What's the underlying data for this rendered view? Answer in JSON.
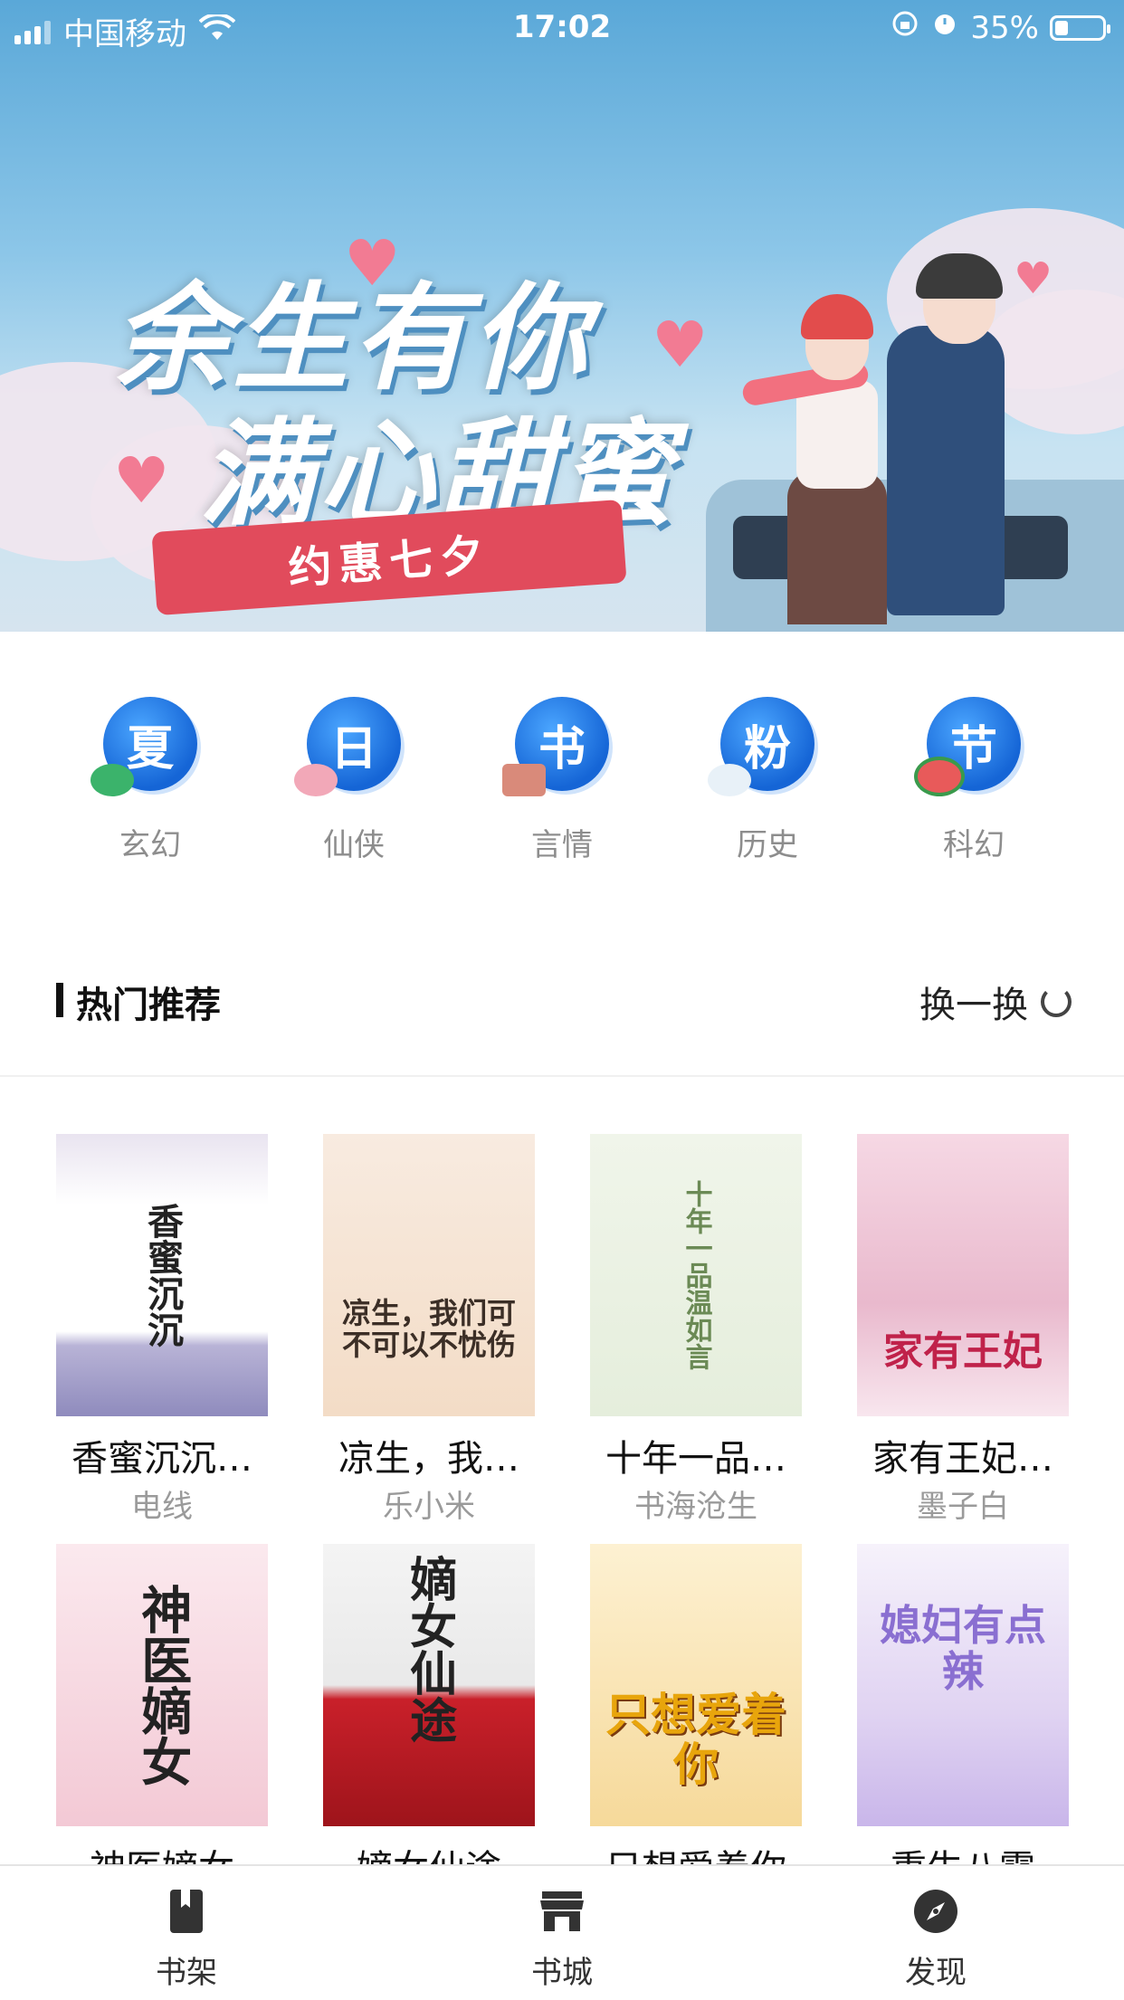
{
  "status_bar": {
    "carrier": "中国移动",
    "time": "17:02",
    "battery": "35%"
  },
  "banner": {
    "title_line1": "余生有你",
    "title_line2": "满心甜蜜",
    "ribbon": "约惠七夕"
  },
  "categories": [
    {
      "icon_text": "夏",
      "label": "玄幻"
    },
    {
      "icon_text": "日",
      "label": "仙侠"
    },
    {
      "icon_text": "书",
      "label": "言情"
    },
    {
      "icon_text": "粉",
      "label": "历史"
    },
    {
      "icon_text": "节",
      "label": "科幻"
    }
  ],
  "section": {
    "title": "热门推荐",
    "refresh_label": "换一换"
  },
  "books_row1": [
    {
      "title": "香蜜沉沉…",
      "author": "电线",
      "cover_text": "香蜜沉沉"
    },
    {
      "title": "凉生，我…",
      "author": "乐小米",
      "cover_text": "凉生，我们可不可以不忧伤"
    },
    {
      "title": "十年一品…",
      "author": "书海沧生",
      "cover_text": "十年一品温如言"
    },
    {
      "title": "家有王妃…",
      "author": "墨子白",
      "cover_text": "家有王妃"
    }
  ],
  "books_row2": [
    {
      "title": "神医嫡女",
      "cover_text": "神医嫡女"
    },
    {
      "title": "嫡女仙途",
      "cover_text": "嫡女仙途"
    },
    {
      "title": "只想爱着你",
      "cover_text": "只想爱着你"
    },
    {
      "title": "重生八零",
      "cover_text": "媳妇有点辣"
    }
  ],
  "tabbar": [
    {
      "label": "书架",
      "icon": "bookshelf-icon"
    },
    {
      "label": "书城",
      "icon": "store-icon"
    },
    {
      "label": "发现",
      "icon": "compass-icon"
    }
  ],
  "colors": {
    "category_blue": "#1565d6",
    "banner_sky": "#5aa8d8",
    "ribbon_red": "#e14b5c"
  }
}
